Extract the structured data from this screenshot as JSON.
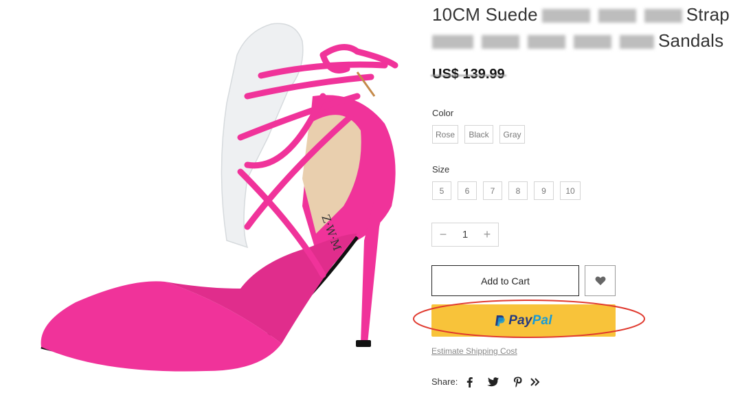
{
  "product": {
    "title_line1_start": "10CM Suede",
    "title_line1_end": "Strap",
    "title_line2_end": "Sandals",
    "price": "US$ 139.99"
  },
  "color": {
    "label": "Color",
    "options": [
      "Rose",
      "Black",
      "Gray"
    ]
  },
  "size": {
    "label": "Size",
    "options": [
      "5",
      "6",
      "7",
      "8",
      "9",
      "10"
    ]
  },
  "quantity": {
    "minus": "−",
    "value": "1",
    "plus": "+"
  },
  "actions": {
    "add_to_cart": "Add to Cart",
    "wishlist_icon": "heart-icon",
    "paypal_pay": "Pay",
    "paypal_pal": "Pal",
    "estimate_shipping": "Estimate Shipping Cost"
  },
  "share": {
    "label": "Share:",
    "icons": [
      "facebook-icon",
      "twitter-icon",
      "pinterest-icon",
      "more-icon"
    ]
  },
  "colors": {
    "shoe_pink": "#f0339a",
    "paypal_yellow": "#f8c33a",
    "paypal_dark_blue": "#253b80",
    "paypal_light_blue": "#179bd7",
    "highlight_red": "#e03a2f"
  }
}
